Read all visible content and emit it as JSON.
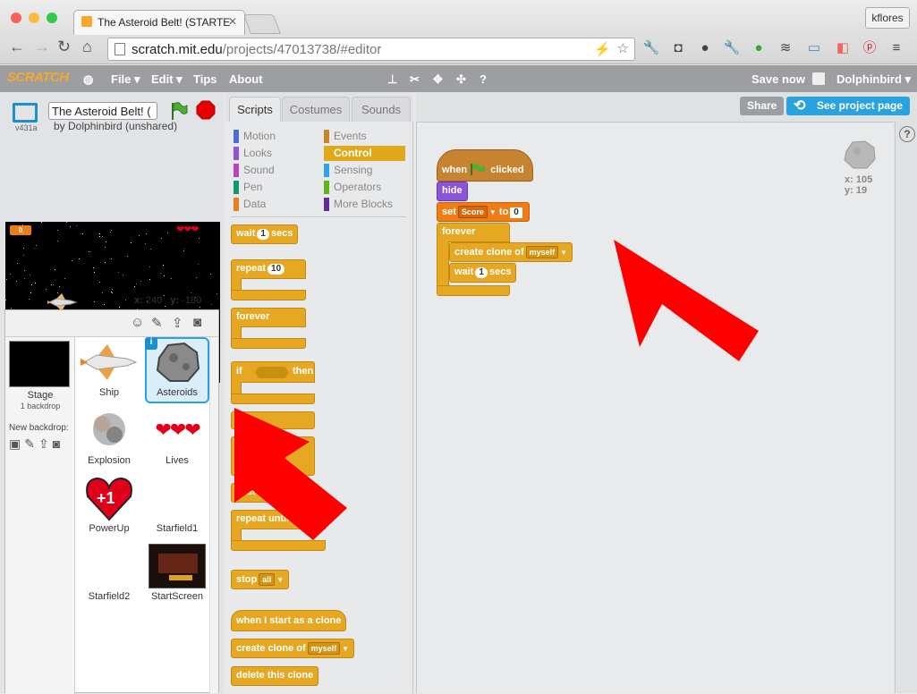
{
  "browser": {
    "tab_title": "The Asteroid Belt! (STARTE",
    "user": "kflores",
    "url_host": "scratch.mit.edu",
    "url_path": "/projects/47013738/#editor"
  },
  "menubar": {
    "logo": "SCRATCH",
    "file": "File ▾",
    "edit": "Edit ▾",
    "tips": "Tips",
    "about": "About",
    "save": "Save now",
    "account": "Dolphinbird ▾"
  },
  "stage": {
    "version": "v431a",
    "project_title": "The Asteroid Belt! (",
    "byline": "by Dolphinbird (unshared)",
    "score": "0",
    "x_label": "x:",
    "x_value": "240",
    "y_label": "y:",
    "y_value": "-180"
  },
  "sprites": {
    "stage_label": "Stage",
    "stage_sub": "1 backdrop",
    "new_backdrop": "New backdrop:",
    "items": [
      {
        "name": "Ship"
      },
      {
        "name": "Asteroids"
      },
      {
        "name": "Explosion"
      },
      {
        "name": "Lives"
      },
      {
        "name": "PowerUp"
      },
      {
        "name": "Starfield1"
      },
      {
        "name": "Starfield2"
      },
      {
        "name": "StartScreen"
      }
    ],
    "powerup_text": "+1"
  },
  "tabs": {
    "scripts": "Scripts",
    "costumes": "Costumes",
    "sounds": "Sounds"
  },
  "categories": {
    "motion": "Motion",
    "looks": "Looks",
    "sound": "Sound",
    "pen": "Pen",
    "data": "Data",
    "events": "Events",
    "control": "Control",
    "sensing": "Sensing",
    "operators": "Operators",
    "more": "More Blocks"
  },
  "palette": {
    "wait": "wait",
    "wait_val": "1",
    "secs": "secs",
    "repeat": "repeat",
    "repeat_val": "10",
    "forever": "forever",
    "if": "if",
    "then": "then",
    "wait_until": "wait until",
    "repeat_until": "repeat until",
    "stop": "stop",
    "stop_opt": "all",
    "start_clone": "when I start as a clone",
    "create_clone": "create clone of",
    "clone_opt": "myself",
    "delete_clone": "delete this clone"
  },
  "script": {
    "when": "when",
    "clicked": "clicked",
    "hide": "hide",
    "set": "set",
    "var": "Score",
    "to": "to",
    "set_val": "0",
    "forever": "forever",
    "create_clone": "create clone of",
    "clone_opt": "myself",
    "wait": "wait",
    "wait_val": "1",
    "secs": "secs"
  },
  "header_buttons": {
    "share": "Share",
    "see_project": "See project page"
  },
  "sprite_info": {
    "x": "x: 105",
    "y": "y: 19"
  },
  "colors": {
    "motion": "#4a6cd4",
    "looks": "#8a55d7",
    "sound": "#bb42c3",
    "pen": "#0e9a6c",
    "data": "#ee7d16",
    "events": "#c88330",
    "control": "#e1a91a",
    "sensing": "#2ca5e2",
    "operators": "#5cb712",
    "more": "#632d99",
    "arrow": "#ff0000"
  }
}
